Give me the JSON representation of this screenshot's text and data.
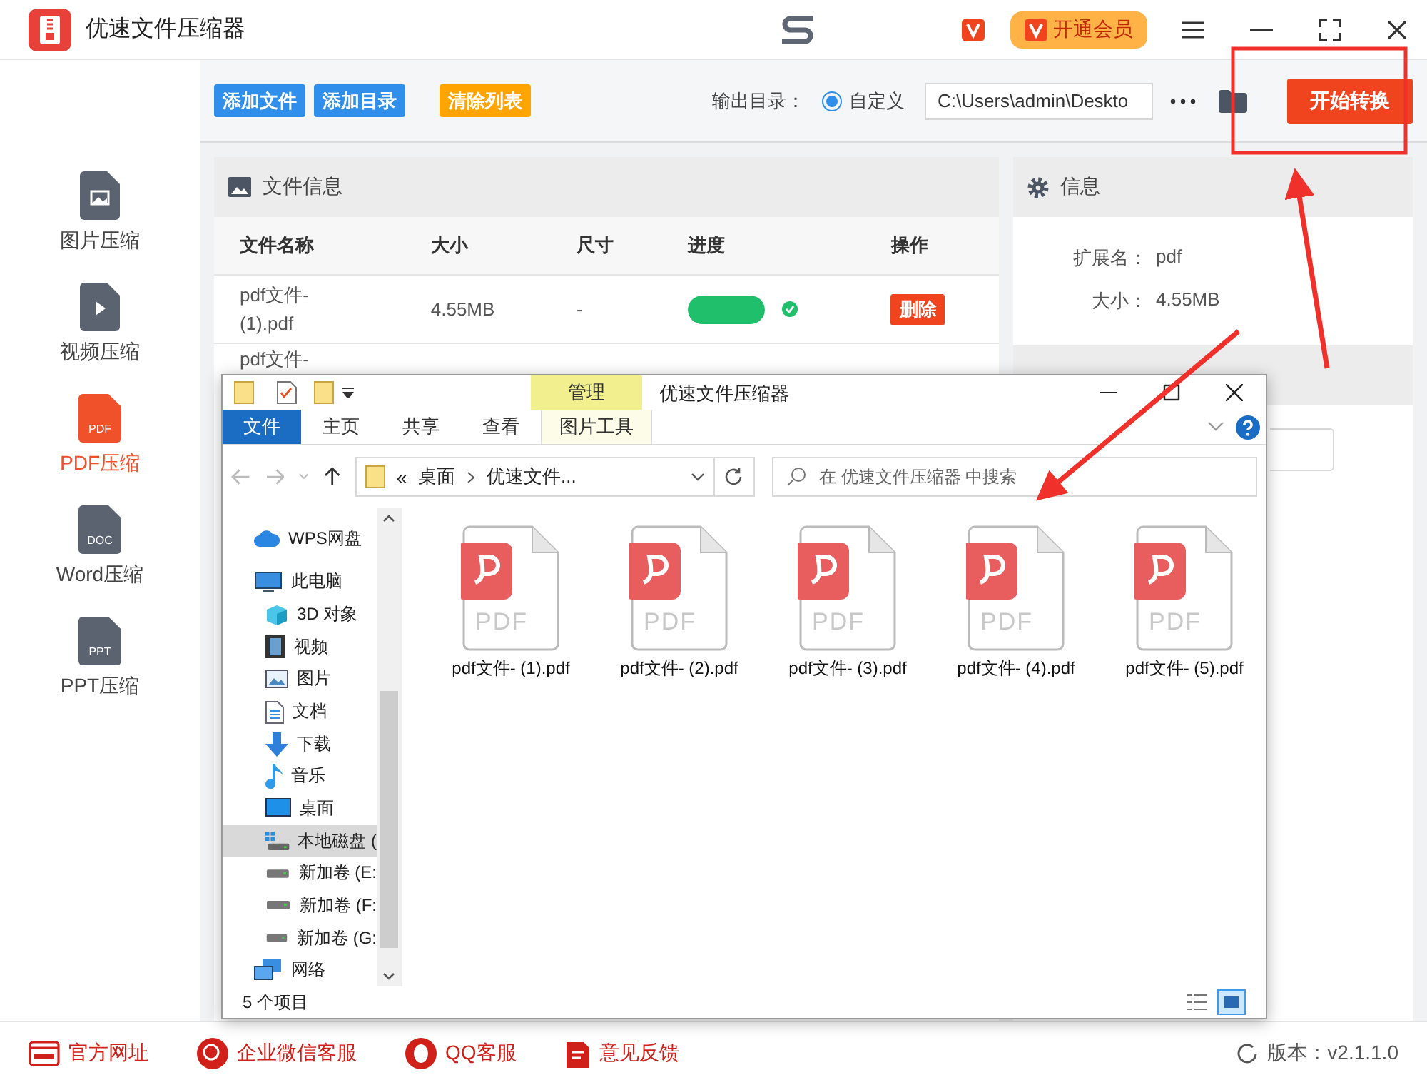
{
  "app": {
    "title": "优速文件压缩器",
    "vip_button": "开通会员"
  },
  "sidebar": [
    {
      "kind": "image",
      "label": "图片压缩",
      "selected": false
    },
    {
      "kind": "video",
      "label": "视频压缩",
      "selected": false
    },
    {
      "kind": "badge",
      "badge": "PDF",
      "label": "PDF压缩",
      "selected": true
    },
    {
      "kind": "badge",
      "badge": "DOC",
      "label": "Word压缩",
      "selected": false
    },
    {
      "kind": "badge",
      "badge": "PPT",
      "label": "PPT压缩",
      "selected": false
    }
  ],
  "toolbar": {
    "buttons": [
      {
        "label": "添加文件",
        "kind": "blue"
      },
      {
        "label": "添加目录",
        "kind": "blue"
      },
      {
        "label": "清除列表",
        "kind": "orange"
      }
    ],
    "output_label": "输出目录：",
    "radio": {
      "label": "自定义",
      "selected": true
    },
    "path": "C:\\Users\\admin\\Deskto",
    "start_button": "开始转换"
  },
  "file_panel": {
    "title": "文件信息",
    "columns": [
      "文件名称",
      "大小",
      "尺寸",
      "进度",
      "操作"
    ],
    "rows": [
      {
        "name": "pdf文件-(1).pdf",
        "size": "4.55MB",
        "dimensions": "-",
        "level": 1,
        "done": true,
        "action": "删除"
      },
      {
        "name": "pdf文件-"
      }
    ]
  },
  "info_panel": {
    "title": "信息",
    "fields": [
      {
        "label": "扩展名：",
        "value": "pdf"
      },
      {
        "label": "大小：",
        "value": "4.55MB"
      }
    ]
  },
  "explorer": {
    "title": "优速文件压缩器",
    "context_tab": "管理",
    "tabs": [
      {
        "label": "文件",
        "selected": true
      },
      {
        "label": "主页",
        "selected": false
      },
      {
        "label": "共享",
        "selected": false
      },
      {
        "label": "查看",
        "selected": false
      },
      {
        "label": "图片工具",
        "selected": false
      }
    ],
    "breadcrumb": {
      "prefix": "«",
      "parts": [
        "桌面",
        "优速文件..."
      ]
    },
    "search": {
      "placeholder": "在 优速文件压缩器 中搜索"
    },
    "nav": [
      {
        "kind": "cloud",
        "label": "WPS网盘",
        "selected": false
      },
      {
        "kind": "pc",
        "label": "此电脑",
        "selected": false,
        "children": [
          {
            "kind": "cube",
            "label": "3D 对象",
            "selected": false
          },
          {
            "kind": "film",
            "label": "视频",
            "selected": false
          },
          {
            "kind": "photo",
            "label": "图片",
            "selected": false
          },
          {
            "kind": "doc",
            "label": "文档",
            "selected": false
          },
          {
            "kind": "download",
            "label": "下载",
            "selected": false
          },
          {
            "kind": "music",
            "label": "音乐",
            "selected": false
          },
          {
            "kind": "desktop",
            "label": "桌面",
            "selected": false
          },
          {
            "kind": "localdisk",
            "label": "本地磁盘 (",
            "selected": true
          },
          {
            "kind": "drive",
            "label": "新加卷 (E:",
            "selected": false
          },
          {
            "kind": "drive",
            "label": "新加卷 (F:",
            "selected": false
          },
          {
            "kind": "drive",
            "label": "新加卷 (G:",
            "selected": false
          }
        ]
      },
      {
        "kind": "network",
        "label": "网络",
        "selected": false
      }
    ],
    "files": [
      {
        "name": "pdf文件- (1).pdf",
        "badge": "PDF"
      },
      {
        "name": "pdf文件- (2).pdf",
        "badge": "PDF"
      },
      {
        "name": "pdf文件- (3).pdf",
        "badge": "PDF"
      },
      {
        "name": "pdf文件- (4).pdf",
        "badge": "PDF"
      },
      {
        "name": "pdf文件- (5).pdf",
        "badge": "PDF"
      }
    ],
    "status": "5 个项目"
  },
  "footer": {
    "links": [
      {
        "kind": "web",
        "label": "官方网址"
      },
      {
        "kind": "wechat",
        "label": "企业微信客服"
      },
      {
        "kind": "qq",
        "label": "QQ客服"
      },
      {
        "kind": "feedback",
        "label": "意见反馈"
      }
    ],
    "version": "版本：v2.1.1.0"
  }
}
